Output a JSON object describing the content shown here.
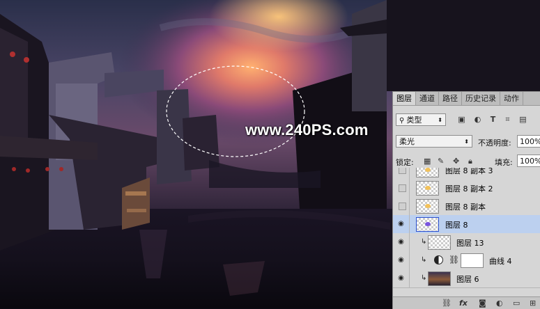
{
  "image": {
    "watermark": "www.240PS.com"
  },
  "panel": {
    "tabs": [
      "图层",
      "通道",
      "路径",
      "历史记录",
      "动作"
    ],
    "active_tab": "图层",
    "filter": {
      "value": "类型"
    },
    "blend_mode": {
      "value": "柔光"
    },
    "opacity": {
      "label": "不透明度:",
      "value": "100%"
    },
    "lock": {
      "label": "锁定:"
    },
    "fill": {
      "label": "填充:",
      "value": "100%"
    },
    "layers": [
      {
        "name": "图层 8 副本 3",
        "visible": false,
        "thumb": "transparent-glow",
        "selected": false
      },
      {
        "name": "图层 8 副本 2",
        "visible": false,
        "thumb": "transparent-glow",
        "selected": false
      },
      {
        "name": "图层 8 副本",
        "visible": false,
        "thumb": "transparent-glow",
        "selected": false
      },
      {
        "name": "图层 8",
        "visible": true,
        "thumb": "transparent-purple",
        "selected": true
      },
      {
        "name": "图层 13",
        "visible": true,
        "thumb": "transparent",
        "clipped": true,
        "selected": false
      },
      {
        "name": "曲线 4",
        "visible": true,
        "thumb": "mask-white",
        "clipped": true,
        "adjustment": true,
        "selected": false
      },
      {
        "name": "图层 6",
        "visible": true,
        "thumb": "image",
        "clipped": true,
        "selected": false
      }
    ],
    "bottom_icons": [
      "link-icon",
      "fx-icon",
      "mask-icon",
      "adjustment-icon",
      "folder-icon",
      "new-layer-icon"
    ],
    "bottom_fx_label": "fx"
  },
  "colors": {
    "selection_highlight": "#bcd0ef",
    "panel_bg": "#d6d6d6",
    "glow_thumb": "#f2c15a",
    "purple_thumb": "#7a55e0"
  }
}
